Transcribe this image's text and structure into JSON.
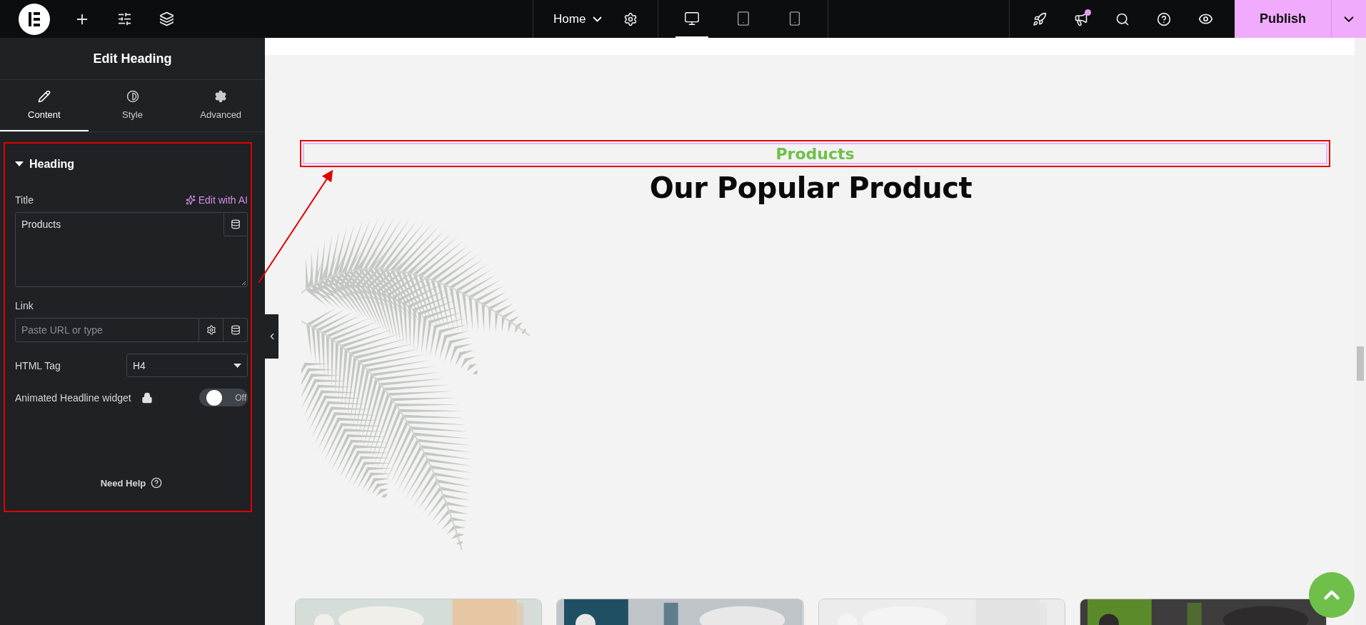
{
  "top_bar": {
    "page_name": "Home",
    "devices": [
      {
        "kind": "desktop",
        "selected": true
      },
      {
        "kind": "tablet",
        "selected": false
      },
      {
        "kind": "mobile",
        "selected": false
      }
    ],
    "has_notification": true,
    "publish_button": "Publish"
  },
  "panel": {
    "title": "Edit Heading",
    "tabs": [
      {
        "kind": "content",
        "label": "Content",
        "selected": true
      },
      {
        "kind": "style",
        "label": "Style",
        "selected": false
      },
      {
        "kind": "advanced",
        "label": "Advanced",
        "selected": false
      }
    ],
    "section": {
      "title": "Heading",
      "expanded": true
    },
    "title_label": "Title",
    "ai_link": "Edit with AI",
    "title_value": "Products",
    "link_label": "Link",
    "link_placeholder": "Paste URL or type",
    "html_tag_label": "HTML Tag",
    "html_tag_value": "H4",
    "animated_label": "Animated Headline widget",
    "animated_locked": true,
    "animated_toggle": {
      "on": false,
      "label": "Off"
    },
    "help_link": "Need Help"
  },
  "canvas": {
    "subtitle": "Products",
    "heading": "Our Popular Product"
  }
}
